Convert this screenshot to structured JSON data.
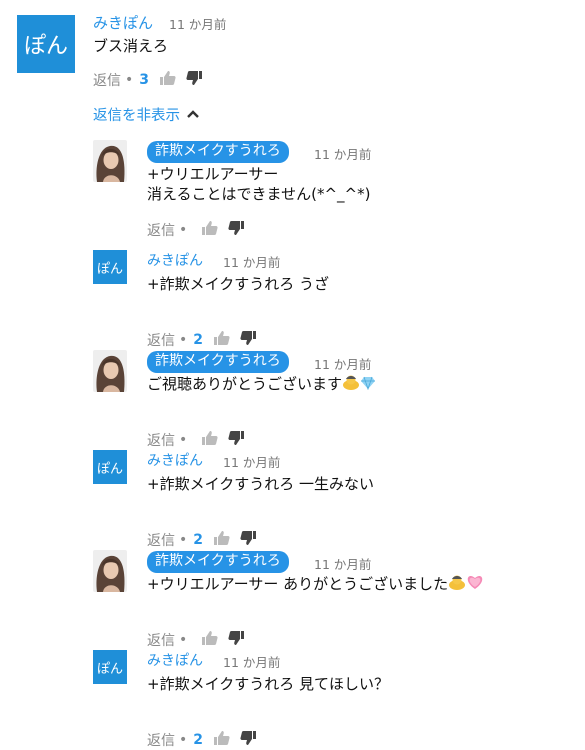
{
  "top_comment": {
    "avatar_text": "ぽん",
    "author": "みきぽん",
    "time": "11 か月前",
    "text": "ブス消えろ",
    "reply_label": "返信",
    "dot": "•",
    "reply_count": "3"
  },
  "hide_replies_label": "返信を非表示",
  "replies": [
    {
      "author": "詐欺メイクすうれろ",
      "badge": true,
      "time": "11 か月前",
      "lines": [
        "+ウリエルアーサー",
        "消えることはできません(*^_^*)"
      ],
      "reply_label": "返信",
      "dot": "•",
      "count": ""
    },
    {
      "author": "みきぽん",
      "badge": false,
      "avatar_text": "ぽん",
      "time": "11 か月前",
      "lines": [
        "+詐欺メイクすうれろ うざ"
      ],
      "reply_label": "返信",
      "dot": "•",
      "count": "2"
    },
    {
      "author": "詐欺メイクすうれろ",
      "badge": true,
      "time": "11 か月前",
      "lines": [
        "ご視聴ありがとうございます"
      ],
      "emojis": [
        "person-bowing-emoji",
        "gem-emoji"
      ],
      "reply_label": "返信",
      "dot": "•",
      "count": ""
    },
    {
      "author": "みきぽん",
      "badge": false,
      "avatar_text": "ぽん",
      "time": "11 か月前",
      "lines": [
        "+詐欺メイクすうれろ 一生みない"
      ],
      "reply_label": "返信",
      "dot": "•",
      "count": "2"
    },
    {
      "author": "詐欺メイクすうれろ",
      "badge": true,
      "time": "11 か月前",
      "lines": [
        "+ウリエルアーサー ありがとうございました"
      ],
      "emojis": [
        "person-bowing-emoji",
        "heart-emoji"
      ],
      "reply_label": "返信",
      "dot": "•",
      "count": ""
    },
    {
      "author": "みきぽん",
      "badge": false,
      "avatar_text": "ぽん",
      "time": "11 か月前",
      "lines": [
        "+詐欺メイクすうれろ 見てほしい？"
      ],
      "reply_label": "返信",
      "dot": "•",
      "count": "2"
    }
  ],
  "colors": {
    "accent": "#2793e6",
    "avatar_bg": "#1f8fd8",
    "muted": "#888888"
  },
  "icons": [
    "thumbs-up-icon",
    "thumbs-down-icon",
    "chevron-up-icon"
  ]
}
